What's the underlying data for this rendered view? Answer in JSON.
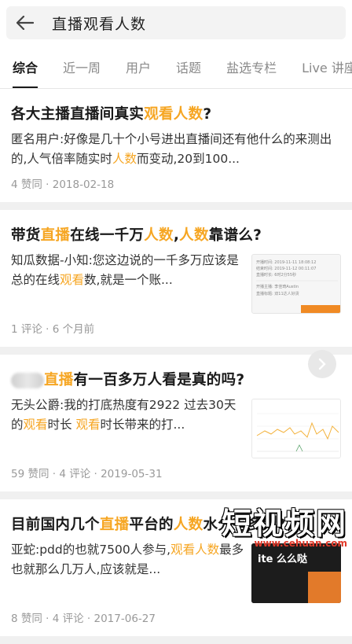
{
  "search": {
    "query": "直播观看人数"
  },
  "tabs": [
    {
      "label": "综合"
    },
    {
      "label": "近一周"
    },
    {
      "label": "用户"
    },
    {
      "label": "话题"
    },
    {
      "label": "盐选专栏"
    },
    {
      "label": "Live 讲座"
    }
  ],
  "results": [
    {
      "title_parts": [
        "各大主播直播间真实",
        "观看人数",
        "?"
      ],
      "excerpt_parts": [
        "匿名用户:好像是几十个小号进出直播间还有他什么的来测出的,人气倍率随实时",
        "人数",
        "而变动,20到100..."
      ],
      "meta": "4 赞同 · 2018-02-18"
    },
    {
      "title_parts": [
        "带货",
        "直播",
        "在线一千万",
        "人数",
        ",",
        "人数",
        "靠谱么?"
      ],
      "excerpt_parts": [
        "知瓜数据-小知:您这边说的一千多万应该是总的在线",
        "观看",
        "数,就是一个账..."
      ],
      "meta": "1 评论 · 6 个月前",
      "thumb": {
        "l1": "开播时间: 2019-11-11 18:08:12",
        "l2": "结束时间: 2019-11-12 00:11:07",
        "l3": "直播时长: 6时2分55秒",
        "l4": "开播主播: 李佳琦Austin",
        "l5": "直播标题: 双11达人好货"
      }
    },
    {
      "title_parts": [
        "直播",
        "有一百多万人看是真的吗?"
      ],
      "excerpt_parts": [
        "无头公爵:我的打底热度有2922 过去30天的",
        "观看",
        "时长 ",
        "观看",
        "时长带来的打..."
      ],
      "meta": "59 赞同 · 4 评论 · 2019-05-31"
    },
    {
      "title_parts": [
        "目前国内几个",
        "直播",
        "平台的",
        "人数",
        "水分有多大?"
      ],
      "excerpt_parts": [
        "亚蛇:pdd的也就7500人参与,",
        "观看人数",
        "最多也就那么几万人,应该就是..."
      ],
      "meta": "8 赞同 · 4 评论 · 2017-06-27",
      "thumb": {
        "text": "ite 么么哒"
      }
    }
  ],
  "watermark": {
    "brand": "短视频网",
    "url": "www.cehuan.com"
  },
  "colors": {
    "highlight": "#f6a623",
    "accent_underline": "#1a1a1a"
  }
}
